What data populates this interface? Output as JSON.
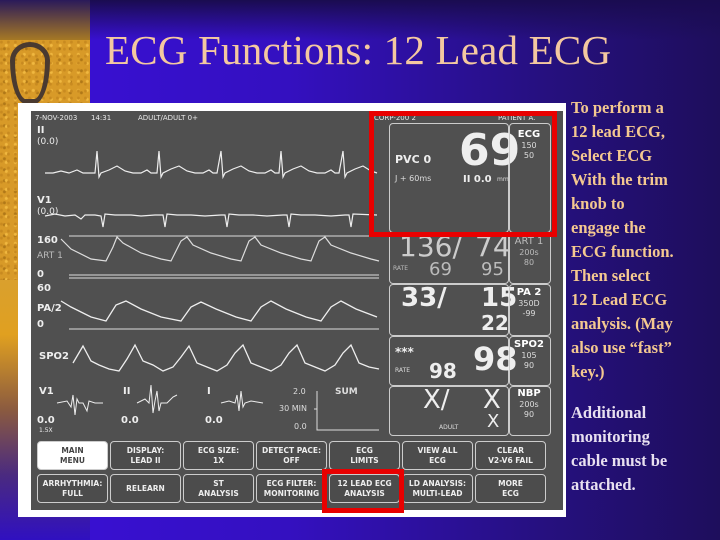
{
  "slide": {
    "title": "ECG Functions:  12 Lead ECG",
    "instructions": [
      "To perform a",
      "12 lead ECG,",
      "Select ECG",
      "With the trim",
      "knob to",
      "engage the",
      "ECG function.",
      "Then select",
      "12 Lead ECG",
      "analysis. (May",
      "also use “fast”",
      "key.)"
    ],
    "note": [
      "Additional",
      "monitoring",
      "cable must be",
      "attached."
    ],
    "colors": {
      "title": "#f4c8a0",
      "highlight": "#e80000",
      "note": "#e8e0f0"
    }
  },
  "monitor": {
    "header": {
      "date": "7-NOV-2003",
      "time": "14:31",
      "mode": "ADULT/ADULT 0+",
      "bed": "CORP-200 2",
      "patient": "PATIENT A."
    },
    "waveforms": [
      {
        "label": "II",
        "sub": "(0.0)"
      },
      {
        "label": "V1",
        "sub": "(0.0)"
      },
      {
        "label": "ART 1",
        "top": "160",
        "bottom": "0"
      },
      {
        "label": "PA/2",
        "top": "60",
        "bottom": "0"
      },
      {
        "label": "SPO2"
      }
    ],
    "st_leads": [
      {
        "label": "V1",
        "value": "0.0",
        "sub": "1.5X"
      },
      {
        "label": "II",
        "value": "0.0"
      },
      {
        "label": "I",
        "value": "0.0"
      }
    ],
    "sum_trend": {
      "label": "SUM",
      "top": "2.0",
      "mid": "30 MIN",
      "bottom": "0.0"
    },
    "params": {
      "ecg": {
        "hr": "69",
        "pvc": "PVC 0",
        "j": "J + 60ms",
        "st": "II 0.0",
        "st_unit": "mm",
        "name": "ECG",
        "hi": "150",
        "lo": "50"
      },
      "art": {
        "sys": "136/",
        "dia": "74",
        "rate_label": "RATE",
        "rate": "69",
        "mean": "95",
        "name": "ART 1",
        "hi": "200s",
        "lo": "80"
      },
      "pa": {
        "sys": "33/",
        "dia": "15",
        "mean": "22",
        "name": "PA 2",
        "hi": "350D",
        "lo": "-99"
      },
      "spo2": {
        "stars": "***",
        "rate_label": "RATE",
        "rate": "98",
        "value": "98",
        "name": "SPO2",
        "hi": "105",
        "lo": "90"
      },
      "nbp": {
        "sys": "X/",
        "dia": "X",
        "mean": "X",
        "mode": "ADULT",
        "name": "NBP",
        "hi": "200s",
        "lo": "90"
      }
    },
    "buttons_row1": [
      "MAIN\nMENU",
      "DISPLAY:\nLEAD II",
      "ECG SIZE:\n1X",
      "DETECT PACE:\nOFF",
      "ECG\nLIMITS",
      "VIEW ALL\nECG",
      "CLEAR\nV2-V6 FAIL"
    ],
    "buttons_row2": [
      "ARRHYTHMIA:\nFULL",
      "RELEARN",
      "ST\nANALYSIS",
      "ECG FILTER:\nMONITORING",
      "12 LEAD ECG\nANALYSIS",
      "LD ANALYSIS:\nMULTI-LEAD",
      "MORE\nECG"
    ]
  }
}
